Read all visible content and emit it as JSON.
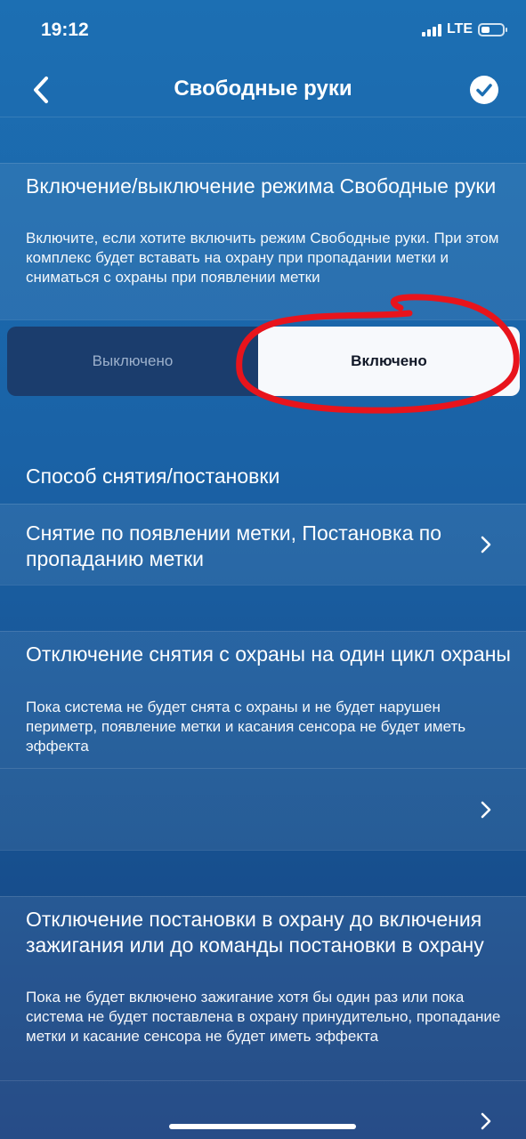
{
  "status_bar": {
    "time": "19:12",
    "network": "LTE"
  },
  "header": {
    "title": "Свободные руки",
    "back_icon": "chevron-left-icon",
    "confirm_icon": "checkmark-circle-icon"
  },
  "hands_free": {
    "title": "Включение/выключение режима Свободные руки",
    "description": "Включите, если хотите включить режим Свободные руки. При этом комплекс будет вставать на охрану при пропадании метки и сниматься с охраны при появлении метки",
    "toggle": {
      "off_label": "Выключено",
      "on_label": "Включено",
      "selected": "Включено"
    },
    "annotation_color": "#e8141c"
  },
  "method": {
    "title": "Способ снятия/постановки",
    "value": "Снятие по появлении метки, Постановка по пропаданию метки"
  },
  "disarm_disable": {
    "title": "Отключение снятия с охраны на один цикл охраны",
    "description": "Пока система не будет снята с охраны и не будет нарушен периметр, появление метки и касания сенсора не будет иметь эффекта",
    "value": ""
  },
  "arm_disable": {
    "title": "Отключение постановки в охрану до включения зажигания или до команды постановки в охрану",
    "description": "Пока не будет включено зажигание хотя бы один раз или пока система не будет поставлена в охрану принудительно, пропадание метки и касание сенсора не будет иметь эффекта",
    "value": ""
  }
}
